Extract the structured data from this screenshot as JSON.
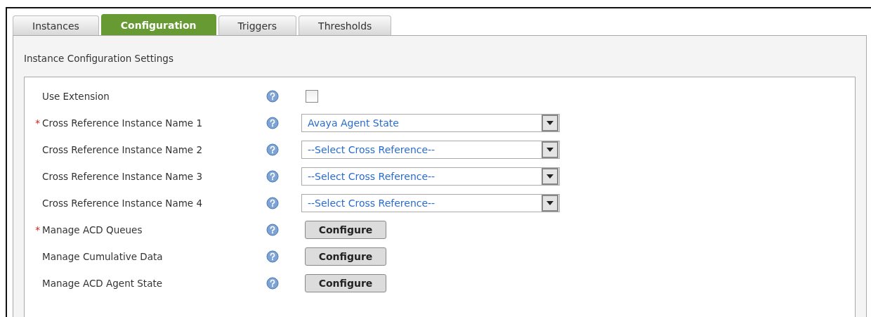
{
  "tabs": [
    {
      "label": "Instances",
      "selected": false
    },
    {
      "label": "Configuration",
      "selected": true
    },
    {
      "label": "Triggers",
      "selected": false
    },
    {
      "label": "Thresholds",
      "selected": false
    }
  ],
  "section_title": "Instance Configuration Settings",
  "rows": [
    {
      "kind": "checkbox",
      "label": "Use Extension",
      "checked": false
    },
    {
      "kind": "select",
      "label": "Cross Reference Instance Name 1",
      "required_mark": "*",
      "value": "Avaya Agent State"
    },
    {
      "kind": "select",
      "label": "Cross Reference Instance Name 2",
      "value": "--Select Cross Reference--"
    },
    {
      "kind": "select",
      "label": "Cross Reference Instance Name 3",
      "value": "--Select Cross Reference--"
    },
    {
      "kind": "select",
      "label": "Cross Reference Instance Name 4",
      "value": "--Select Cross Reference--"
    },
    {
      "kind": "button",
      "label": "Manage ACD Queues",
      "required_mark": "*",
      "button": "Configure"
    },
    {
      "kind": "button",
      "label": "Manage Cumulative Data",
      "button": "Configure"
    },
    {
      "kind": "button",
      "label": "Manage ACD Agent State",
      "button": "Configure"
    }
  ]
}
